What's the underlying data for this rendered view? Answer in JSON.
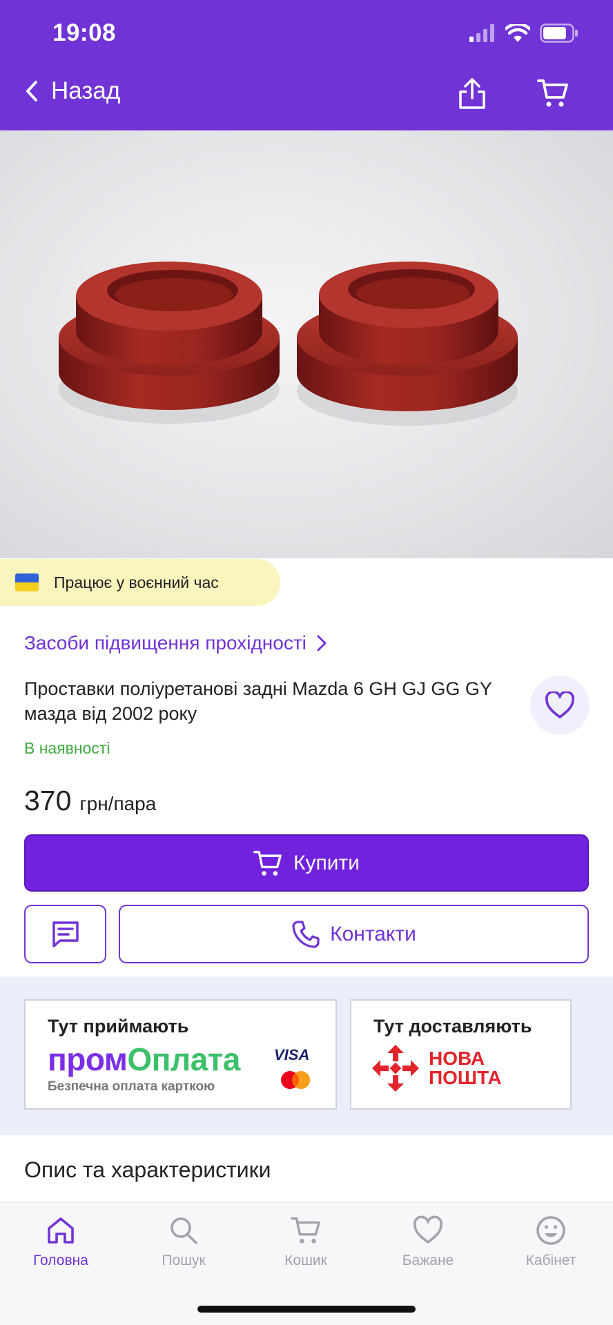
{
  "status_bar": {
    "time": "19:08"
  },
  "nav": {
    "back_label": "Назад",
    "share_icon": "share-icon",
    "cart_icon": "cart-icon"
  },
  "banner": {
    "text": "Працює у воєнний час",
    "flag_colors": [
      "#2f62d6",
      "#f5cf1f"
    ]
  },
  "product": {
    "category": "Засоби підвищення прохідності",
    "title": "Проставки поліуретанові задні Mazda 6 GH GJ GG GY мазда від 2002 року",
    "stock": "В наявності",
    "price": "370",
    "price_unit": "грн/пара"
  },
  "actions": {
    "buy_label": "Купити",
    "contacts_label": "Контакти"
  },
  "payment_card": {
    "title": "Тут приймають",
    "brand_part1": "пром",
    "brand_part2": "Оплата",
    "subtitle": "Безпечна оплата карткою",
    "visa": "VISA"
  },
  "delivery_card": {
    "title": "Тут доставляють",
    "brand_line1": "НОВА",
    "brand_line2": "ПОШТА"
  },
  "section": {
    "description_title": "Опис та характеристики"
  },
  "tabs": [
    {
      "label": "Головна",
      "icon": "home-icon",
      "active": true
    },
    {
      "label": "Пошук",
      "icon": "search-icon",
      "active": false
    },
    {
      "label": "Кошик",
      "icon": "cart-icon",
      "active": false
    },
    {
      "label": "Бажане",
      "icon": "heart-icon",
      "active": false
    },
    {
      "label": "Кабінет",
      "icon": "smiley-icon",
      "active": false
    }
  ],
  "colors": {
    "accent": "#7033d6",
    "stock_green": "#3eab3e",
    "banner_yellow": "#faf4bd"
  }
}
